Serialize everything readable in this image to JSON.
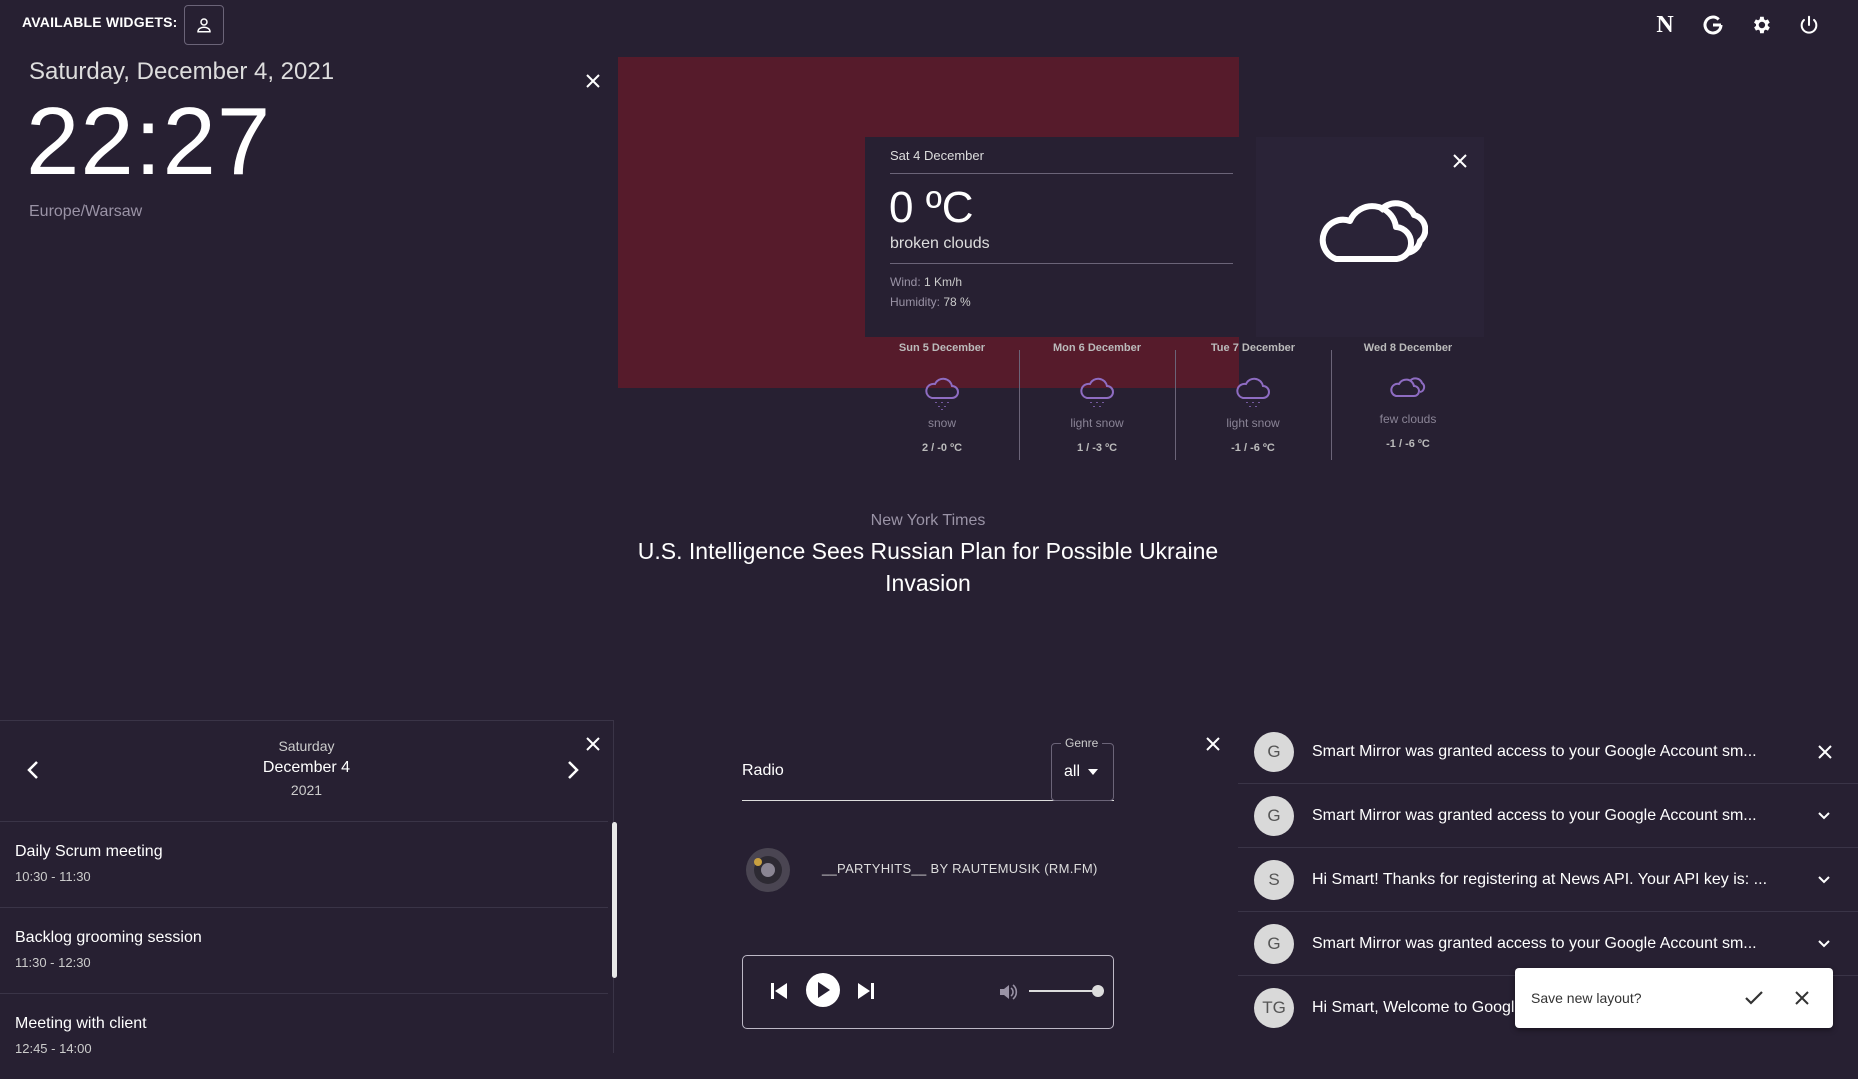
{
  "topbar": {
    "available_widgets_label": "AVAILABLE WIDGETS:",
    "icons": [
      "notion-icon",
      "google-icon",
      "gear-icon",
      "power-icon"
    ],
    "notion_glyph": "N"
  },
  "clock": {
    "date": "Saturday, December 4, 2021",
    "time": "22:27",
    "timezone": "Europe/Warsaw"
  },
  "weather": {
    "date": "Sat 4 December",
    "temperature": "0 ºC",
    "description": "broken clouds",
    "wind_label": "Wind:",
    "wind_value": "1 Km/h",
    "humidity_label": "Humidity:",
    "humidity_value": "78 %",
    "forecast": [
      {
        "day": "Sun 5 December",
        "desc": "snow",
        "temps": "2 / -0 ºC",
        "icon": "snow-cloud-icon"
      },
      {
        "day": "Mon 6 December",
        "desc": "light snow",
        "temps": "1 / -3 ºC",
        "icon": "snow-cloud-icon"
      },
      {
        "day": "Tue 7 December",
        "desc": "light snow",
        "temps": "-1 / -6 ºC",
        "icon": "snow-cloud-icon"
      },
      {
        "day": "Wed 8 December",
        "desc": "few clouds",
        "temps": "-1 / -6 ºC",
        "icon": "cloud-icon"
      }
    ]
  },
  "news": {
    "source": "New York Times",
    "headline": "U.S. Intelligence Sees Russian Plan for Possible Ukraine Invasion"
  },
  "calendar": {
    "weekday": "Saturday",
    "date": "December 4",
    "year": "2021",
    "events": [
      {
        "title": "Daily Scrum meeting",
        "time": "10:30 - 11:30"
      },
      {
        "title": "Backlog grooming session",
        "time": "11:30 - 12:30"
      },
      {
        "title": "Meeting with client",
        "time": "12:45 - 14:00"
      }
    ]
  },
  "radio": {
    "label": "Radio",
    "genre_label": "Genre",
    "genre_value": "all",
    "station": "__PARTYHITS__ BY RAUTEMUSIK (RM.FM)",
    "volume": 0.9
  },
  "mail": {
    "items": [
      {
        "avatar": "G",
        "subject": "Smart Mirror was granted access to your Google Account sm..."
      },
      {
        "avatar": "G",
        "subject": "Smart Mirror was granted access to your Google Account sm..."
      },
      {
        "avatar": "S",
        "subject": "Hi Smart! Thanks for registering at News API. Your API key is: ..."
      },
      {
        "avatar": "G",
        "subject": "Smart Mirror was granted access to your Google Account sm..."
      },
      {
        "avatar": "TG",
        "subject": "Hi Smart, Welcome to Googl"
      }
    ]
  },
  "snackbar": {
    "text": "Save new layout?"
  },
  "colors": {
    "background": "#272032",
    "red_widget": "#561b2b",
    "forecast_icon": "#8e6cc2"
  }
}
